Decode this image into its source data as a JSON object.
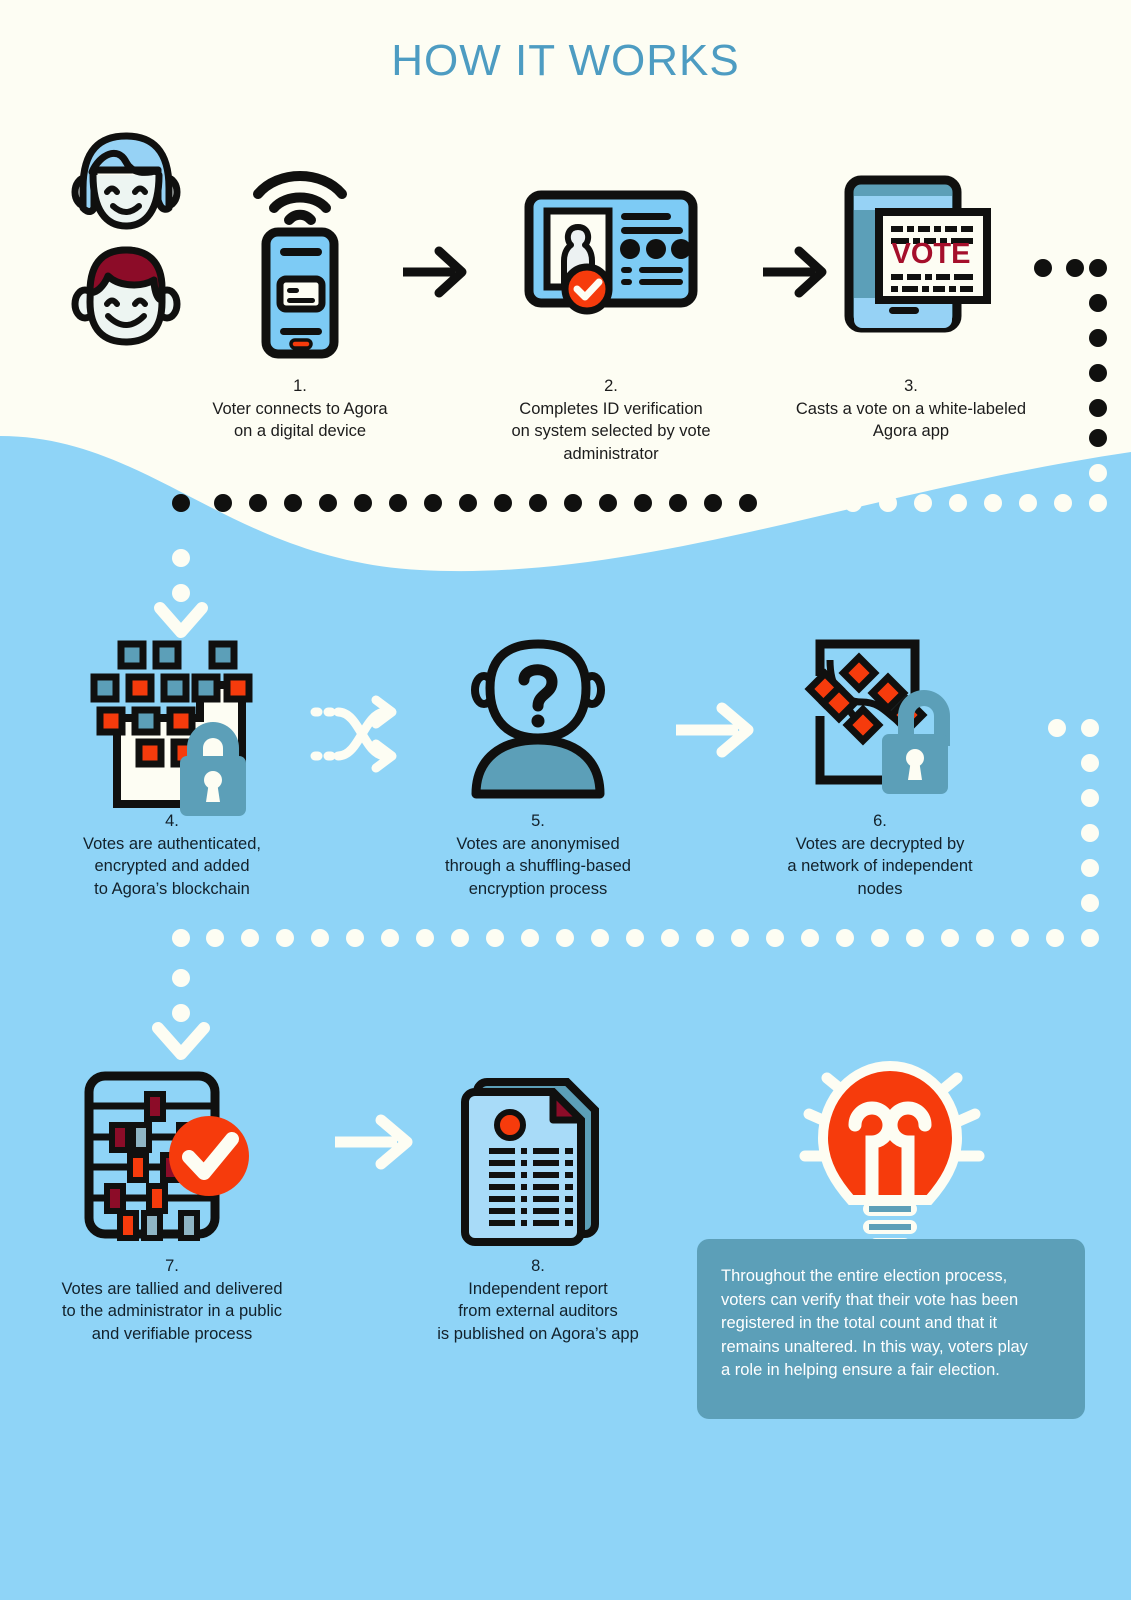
{
  "page": {
    "title": "HOW IT WORKS",
    "colors": {
      "cream_background": "#FDFDF3",
      "blue_background": "#8FD4F7",
      "title_blue": "#4D9CC2",
      "teal": "#5C9FB8",
      "red_orange": "#F63B0C",
      "dark_red": "#A50F2B",
      "outline_black": "#10100F",
      "white": "#FFFFFF"
    }
  },
  "steps": [
    {
      "number": "1.",
      "lines": [
        "Voter connects to Agora",
        "on a digital device"
      ],
      "icon": "smartphone-wifi-icon",
      "extra_icon": "voter-avatars-icon"
    },
    {
      "number": "2.",
      "lines": [
        "Completes ID verification",
        "on system selected by vote",
        "administrator"
      ],
      "icon": "id-card-verified-icon"
    },
    {
      "number": "3.",
      "lines": [
        "Casts a vote on a white-labeled",
        "Agora app"
      ],
      "icon": "ballot-phone-icon",
      "ballot_label": "VOTE"
    },
    {
      "number": "4.",
      "lines": [
        "Votes are authenticated,",
        "encrypted and added",
        "to Agora’s blockchain"
      ],
      "icon": "blockchain-lock-icon"
    },
    {
      "number": "5.",
      "lines": [
        "Votes are anonymised",
        "through a shuffling-based",
        "encryption process"
      ],
      "icon": "anonymous-person-icon"
    },
    {
      "number": "6.",
      "lines": [
        "Votes are decrypted by",
        "a network of independent",
        "nodes"
      ],
      "icon": "network-unlock-icon"
    },
    {
      "number": "7.",
      "lines": [
        "Votes are tallied and delivered",
        "to the administrator in a public",
        "and verifiable process"
      ],
      "icon": "abacus-check-icon"
    },
    {
      "number": "8.",
      "lines": [
        "Independent report",
        "from external auditors",
        "is published on Agora’s app"
      ],
      "icon": "audit-report-icon"
    }
  ],
  "callout": {
    "icon": "lightbulb-icon",
    "lines": [
      "Throughout the entire election process,",
      "voters can verify that their vote has been",
      "registered in the total count and that it",
      "remains unaltered. In this way, voters play",
      "a role in helping ensure a fair election."
    ]
  },
  "connectors": {
    "arrow_1_2": "black-arrow-right",
    "arrow_2_3": "black-arrow-right",
    "arrow_4_5": "white-shuffle-arrow",
    "arrow_5_6": "white-arrow-right",
    "arrow_7_8": "white-arrow-right",
    "path_row1_to_row2": "dotted-path",
    "path_row2_to_row3": "dotted-path",
    "chevron_down_row2": "chevron-down-icon",
    "chevron_down_row3": "chevron-down-icon"
  }
}
